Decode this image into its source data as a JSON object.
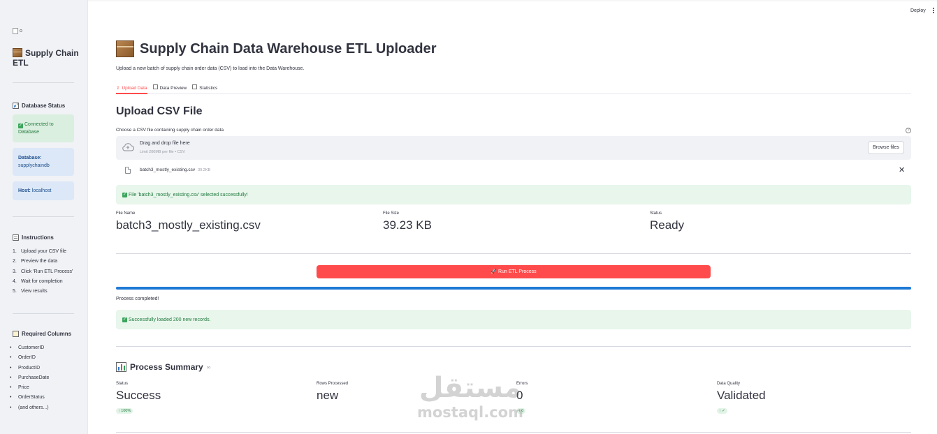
{
  "app": {
    "deploy_label": "Deploy"
  },
  "sidebar": {
    "logo_alt": "o",
    "title": "Supply Chain ETL",
    "db_status_heading": "Database Status",
    "connected_text": "Connected to Database",
    "database_label": "Database:",
    "database_value": "supplychaindb",
    "host_label": "Host:",
    "host_value": "localhost",
    "instructions_heading": "Instructions",
    "instructions": [
      "Upload your CSV file",
      "Preview the data",
      "Click 'Run ETL Process'",
      "Wait for completion",
      "View results"
    ],
    "required_heading": "Required Columns",
    "required_columns": [
      "CustomerID",
      "OrderID",
      "ProductID",
      "PurchaseDate",
      "Price",
      "OrderStatus",
      "(and others...)"
    ]
  },
  "main": {
    "title": "Supply Chain Data Warehouse ETL Uploader",
    "subtitle": "Upload a new batch of supply chain order data (CSV) to load into the Data Warehouse.",
    "tabs": [
      {
        "label": "Upload Data",
        "active": true
      },
      {
        "label": "Data Preview",
        "active": false
      },
      {
        "label": "Statistics",
        "active": false
      }
    ],
    "upload_heading": "Upload CSV File",
    "uploader_label": "Choose a CSV file containing supply chain order data",
    "dropzone_main": "Drag and drop file here",
    "dropzone_sub": "Limit 200MB per file • CSV",
    "browse_label": "Browse files",
    "file": {
      "name": "batch3_mostly_existing.csv",
      "size": "39.2KB"
    },
    "selected_alert": "File 'batch3_mostly_existing.csv' selected successfully!",
    "file_metrics": [
      {
        "label": "File Name",
        "value": "batch3_mostly_existing.csv"
      },
      {
        "label": "File Size",
        "value": "39.23 KB"
      },
      {
        "label": "Status",
        "value": "Ready"
      }
    ],
    "run_button": "Run ETL Process",
    "progress": 1.0,
    "process_text": "Process completed!",
    "loaded_alert": "Successfully loaded 200 new records.",
    "summary_heading": "Process Summary",
    "summary_metrics": [
      {
        "label": "Status",
        "value": "Success",
        "delta": "↑ 100%"
      },
      {
        "label": "Rows Processed",
        "value": "new",
        "delta": ""
      },
      {
        "label": "Errors",
        "value": "0",
        "delta": "↑ 0"
      },
      {
        "label": "Data Quality",
        "value": "Validated",
        "delta": "↑ ✓"
      }
    ]
  },
  "watermark": {
    "arabic": "مستقل",
    "latin": "mostaql.com"
  },
  "colors": {
    "primary": "#ff4b4b",
    "success_bg": "#e8f6ec",
    "success_text": "#217a3c",
    "progress": "#1f7ad6",
    "sidebar_bg": "#f0f2f6"
  }
}
